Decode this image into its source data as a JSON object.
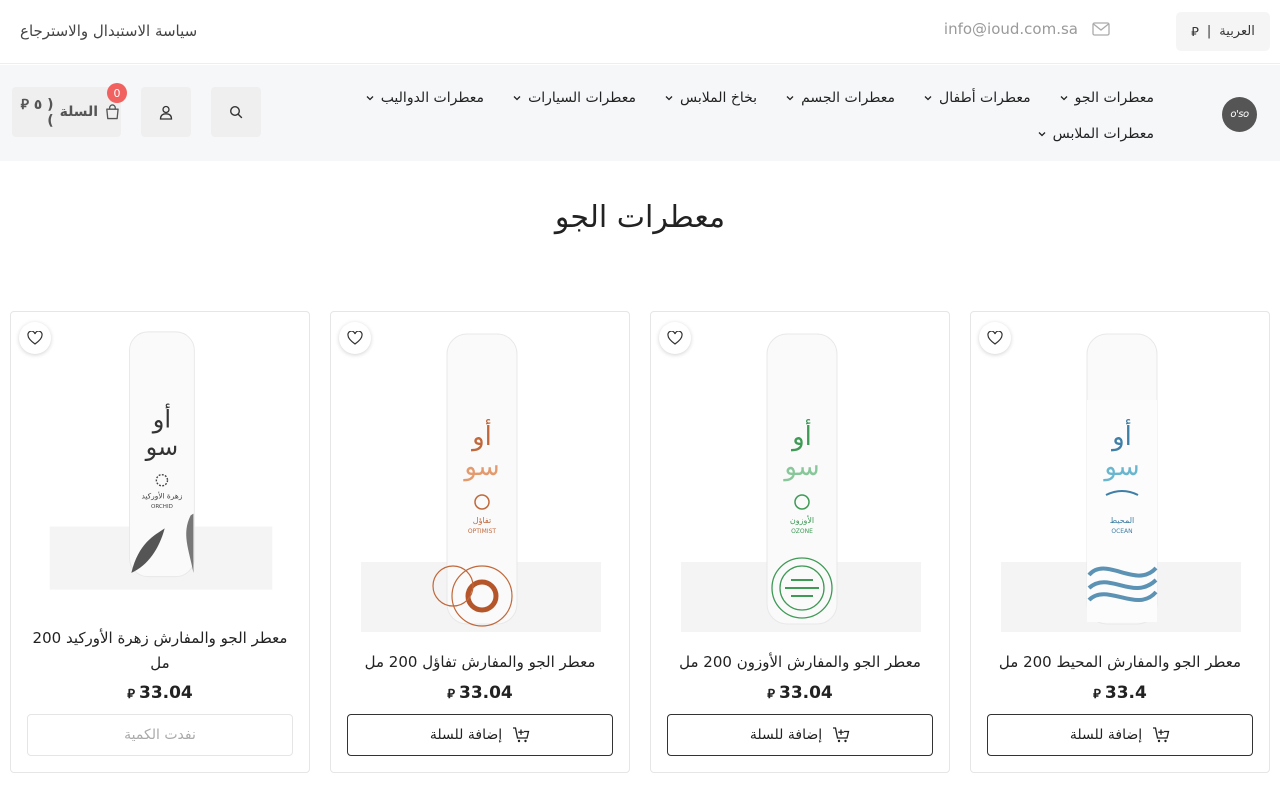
{
  "topbar": {
    "language_label": "العربية",
    "currency_symbol": "⃁",
    "email": "info@ioud.com.sa",
    "policy_link": "سياسة الاستبدال والاسترجاع"
  },
  "header": {
    "logo_text": "o'so",
    "nav_row1": [
      {
        "label": "معطرات الجو"
      },
      {
        "label": "معطرات أطفال"
      },
      {
        "label": "معطرات الجسم"
      },
      {
        "label": "بخاخ الملابس"
      },
      {
        "label": "معطرات السيارات"
      },
      {
        "label": "معطرات الدواليب"
      }
    ],
    "nav_row2": [
      {
        "label": "معطرات الملابس"
      }
    ],
    "cart_label": "السلة",
    "cart_amount": "( ٥ ⃁ )",
    "cart_count": "0"
  },
  "main": {
    "title": "معطرات الجو"
  },
  "products": [
    {
      "name": "معطر الجو والمفارش المحيط 200 مل",
      "price": "33.4",
      "currency": "⃁",
      "action": "إضافة للسلة",
      "available": true,
      "accent": "#3f7fa6",
      "label_en": "OCEAN",
      "label_ar": "المحيط"
    },
    {
      "name": "معطر الجو والمفارش الأوزون 200 مل",
      "price": "33.04",
      "currency": "⃁",
      "action": "إضافة للسلة",
      "available": true,
      "accent": "#3e9a55",
      "label_en": "OZONE",
      "label_ar": "الأوزون"
    },
    {
      "name": "معطر الجو والمفارش تفاؤل 200 مل",
      "price": "33.04",
      "currency": "⃁",
      "action": "إضافة للسلة",
      "available": true,
      "accent": "#c0683a",
      "label_en": "OPTIMIST",
      "label_ar": "تفاؤل"
    },
    {
      "name": "معطر الجو والمفارش زهرة الأوركيد 200 مل",
      "price": "33.04",
      "currency": "⃁",
      "action": "نفدت الكمية",
      "available": false,
      "accent": "#333333",
      "label_en": "ORCHID",
      "label_ar": "زهرة الأوركيد"
    }
  ],
  "bottle_brand": {
    "line1": "أو",
    "line2": "سو"
  }
}
